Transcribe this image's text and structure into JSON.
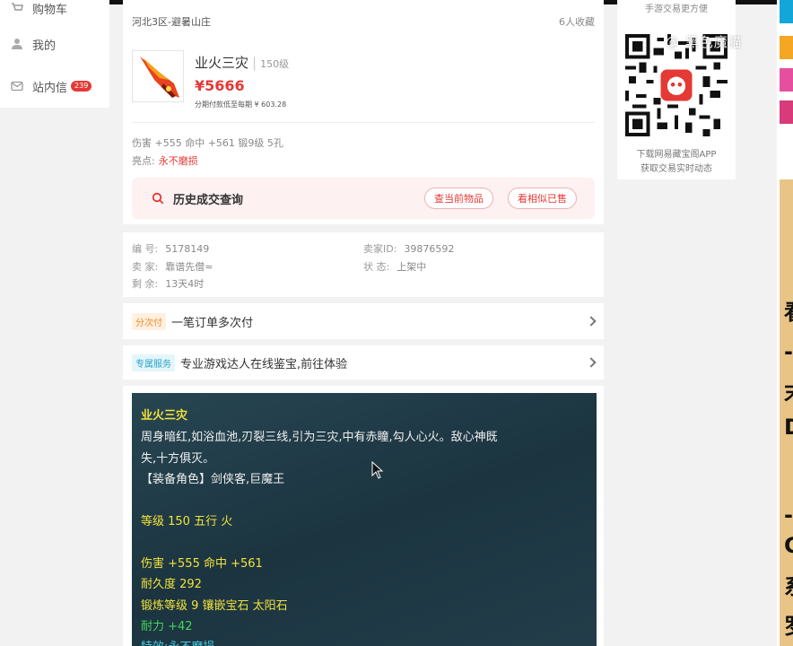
{
  "nav": {
    "items": [
      {
        "label": "购物车"
      },
      {
        "label": "我的"
      },
      {
        "label": "站内信",
        "badge": "239"
      }
    ]
  },
  "listing": {
    "server": "河北3区-避暑山庄",
    "favorites": "6人收藏",
    "name": "业火三灾",
    "level": "150级",
    "price": "¥5666",
    "installment": "分期付款低至每期 ¥ 603.28",
    "stats": "伤害 +555 命中 +561 锻9级 5孔",
    "perk_label": "亮点:",
    "perk_value": "永不磨损",
    "history_title": "历史成交查询",
    "history_btn_current": "查当前物品",
    "history_btn_similar": "看相似已售"
  },
  "info": {
    "id_label": "编 号:",
    "id_value": "5178149",
    "seller_id_label": "卖家ID:",
    "seller_id_value": "39876592",
    "seller_label": "卖 家:",
    "seller_value": "靠谱先僧≈",
    "status_label": "状 态:",
    "status_value": "上架中",
    "remain_label": "剩 余:",
    "remain_value": "13天4时"
  },
  "promo": {
    "installment_tag": "分次付",
    "installment_text": "一笔订单多次付",
    "expert_tag": "专属服务",
    "expert_text": "专业游戏达人在线鉴宝,前往体验"
  },
  "description": {
    "title": "业火三灾",
    "line1": "周身暗红,如浴血池,刃裂三线,引为三灾,中有赤瞳,勾人心火。敌心神既",
    "line2": "失,十方俱灭。",
    "line3": "【装备角色】剑侠客,巨魔王",
    "line4": "等级 150 五行 火",
    "line5": "伤害 +555 命中 +561",
    "line6": "耐久度 292",
    "line7": "锻炼等级 9 镶嵌宝石 太阳石",
    "line8": "耐力 +42",
    "line9": "特效:永不磨损"
  },
  "sidebar": {
    "top_text": "手游交易更方便",
    "caption1": "下载网易藏宝阁APP",
    "caption2": "获取交易实时动态",
    "watermark": "@ 黑色魔猫"
  },
  "strip": {
    "blocks": [
      "#12a7d8",
      "#f5a623",
      "#e64fa0",
      "#d93a7a"
    ],
    "chars": [
      "看",
      "-",
      "末",
      "D",
      "-",
      "C",
      "系",
      "罗"
    ]
  }
}
